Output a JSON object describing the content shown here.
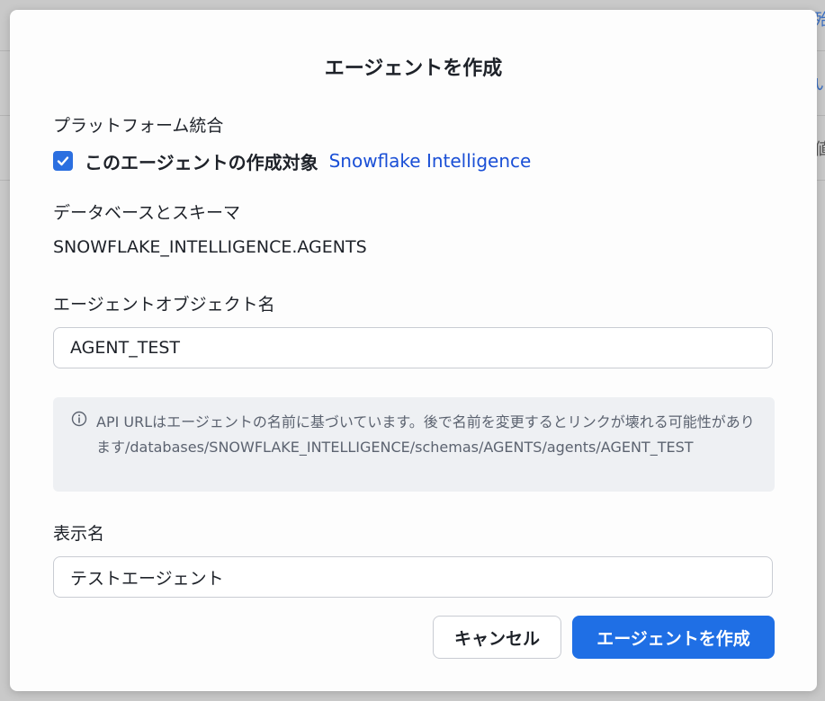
{
  "background": {
    "glyphs": [
      "殆",
      "い",
      "値"
    ]
  },
  "dialog": {
    "title": "エージェントを作成",
    "platform_label": "プラットフォーム統合",
    "checkbox": {
      "checked": true,
      "text": "このエージェントの作成対象",
      "link": "Snowflake Intelligence"
    },
    "database_label": "データベースとスキーマ",
    "database_value": "SNOWFLAKE_INTELLIGENCE.AGENTS",
    "object_name_label": "エージェントオブジェクト名",
    "object_name_value": "AGENT_TEST",
    "info_text": "API URLはエージェントの名前に基づいています。後で名前を変更するとリンクが壊れる可能性があります/databases/SNOWFLAKE_INTELLIGENCE/schemas/AGENTS/agents/AGENT_TEST",
    "display_name_label": "表示名",
    "display_name_value": "テストエージェント",
    "cancel_label": "キャンセル",
    "create_label": "エージェントを作成"
  },
  "colors": {
    "accent": "#1f6fe5",
    "link": "#1a4fd6",
    "info_bg": "#eef0f3"
  }
}
